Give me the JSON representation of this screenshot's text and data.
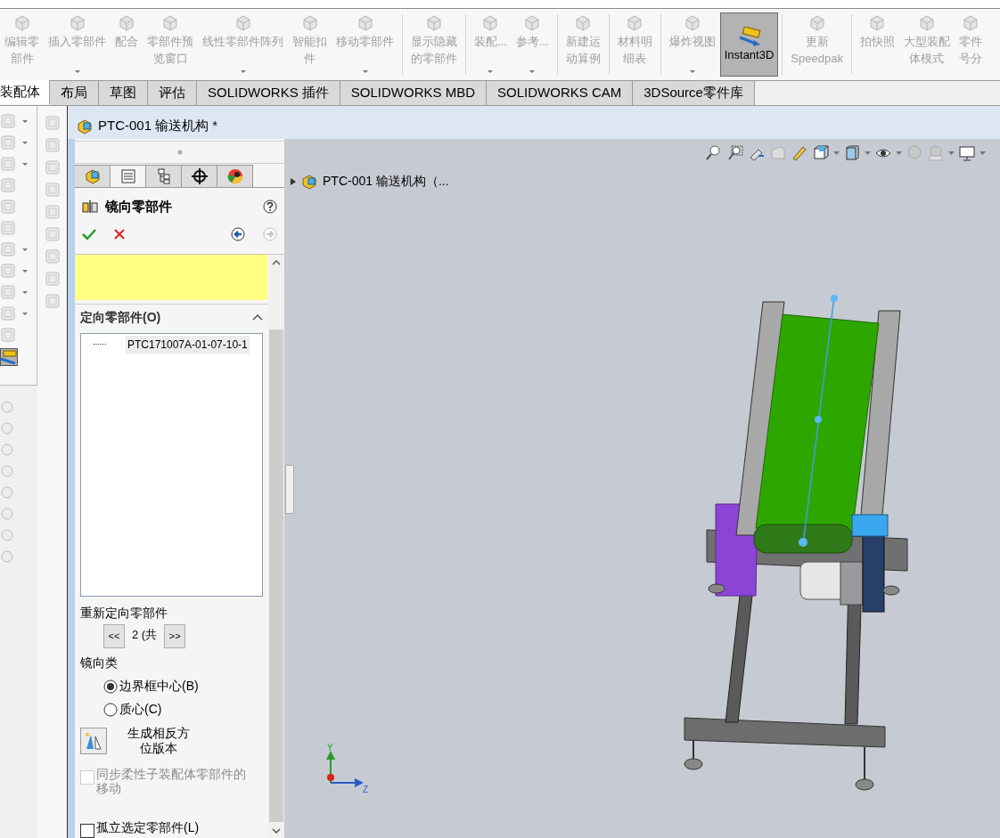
{
  "ribbon": {
    "items": [
      {
        "kind": "button",
        "lines": [
          "编辑零",
          "部件"
        ],
        "disabled": true,
        "dropdown": false,
        "selected": false
      },
      {
        "kind": "button",
        "lines": [
          "插入零部件"
        ],
        "disabled": true,
        "dropdown": true,
        "selected": false
      },
      {
        "kind": "button",
        "lines": [
          "配合"
        ],
        "disabled": true,
        "dropdown": false,
        "selected": false
      },
      {
        "kind": "button",
        "lines": [
          "零部件预",
          "览窗口"
        ],
        "disabled": true,
        "dropdown": false,
        "selected": false
      },
      {
        "kind": "button",
        "lines": [
          "线性零部件阵列"
        ],
        "disabled": true,
        "dropdown": true,
        "selected": false
      },
      {
        "kind": "button",
        "lines": [
          "智能扣",
          "件"
        ],
        "disabled": true,
        "dropdown": false,
        "selected": false
      },
      {
        "kind": "button",
        "lines": [
          "移动零部件"
        ],
        "disabled": true,
        "dropdown": true,
        "selected": false
      },
      {
        "kind": "separator"
      },
      {
        "kind": "button",
        "lines": [
          "显示隐藏",
          "的零部件"
        ],
        "disabled": true,
        "dropdown": false,
        "selected": false
      },
      {
        "kind": "separator"
      },
      {
        "kind": "button",
        "lines": [
          "装配..."
        ],
        "disabled": true,
        "dropdown": true,
        "selected": false
      },
      {
        "kind": "button",
        "lines": [
          "参考..."
        ],
        "disabled": true,
        "dropdown": true,
        "selected": false
      },
      {
        "kind": "separator"
      },
      {
        "kind": "button",
        "lines": [
          "新建运",
          "动算例"
        ],
        "disabled": true,
        "dropdown": false,
        "selected": false
      },
      {
        "kind": "separator"
      },
      {
        "kind": "button",
        "lines": [
          "材料明",
          "细表"
        ],
        "disabled": true,
        "dropdown": false,
        "selected": false
      },
      {
        "kind": "separator"
      },
      {
        "kind": "button",
        "lines": [
          "爆炸视图"
        ],
        "disabled": true,
        "dropdown": true,
        "selected": false
      },
      {
        "kind": "button",
        "lines": [
          "Instant3D"
        ],
        "disabled": false,
        "dropdown": false,
        "selected": true
      },
      {
        "kind": "separator"
      },
      {
        "kind": "button",
        "lines": [
          "更新",
          "Speedpak"
        ],
        "disabled": true,
        "dropdown": false,
        "selected": false
      },
      {
        "kind": "separator"
      },
      {
        "kind": "button",
        "lines": [
          "拍快照"
        ],
        "disabled": true,
        "dropdown": false,
        "selected": false
      },
      {
        "kind": "button",
        "lines": [
          "大型装配",
          "体模式"
        ],
        "disabled": true,
        "dropdown": false,
        "selected": false
      },
      {
        "kind": "button",
        "lines": [
          "零件",
          "号分"
        ],
        "disabled": true,
        "dropdown": false,
        "selected": false
      }
    ]
  },
  "tabs": [
    {
      "label": "装配体",
      "selected": true
    },
    {
      "label": "布局",
      "selected": false
    },
    {
      "label": "草图",
      "selected": false
    },
    {
      "label": "评估",
      "selected": false
    },
    {
      "label": "SOLIDWORKS 插件",
      "selected": false
    },
    {
      "label": "SOLIDWORKS MBD",
      "selected": false
    },
    {
      "label": "SOLIDWORKS CAM",
      "selected": false
    },
    {
      "label": "3DSource零件库",
      "selected": false
    }
  ],
  "document": {
    "title": "PTC-001 输送机构 *"
  },
  "property_manager": {
    "tabs": [
      {
        "kind": "feature",
        "selected": false
      },
      {
        "kind": "property",
        "selected": true
      },
      {
        "kind": "config",
        "selected": false
      },
      {
        "kind": "dimxpert",
        "selected": false
      },
      {
        "kind": "display",
        "selected": false
      }
    ],
    "title": "镜向零部件",
    "forward_disabled": true,
    "section": {
      "title": "定向零部件(O)",
      "expanded": true,
      "items": [
        "PTC171007A-01-07-10-1"
      ]
    },
    "reorient": {
      "label": "重新定向零部件",
      "prev": "<<",
      "count": "2 (共",
      "next": ">>"
    },
    "mirror_type": {
      "label": "镜向类",
      "options": [
        {
          "label": "边界框中心(B)",
          "selected": true
        },
        {
          "label": "质心(C)",
          "selected": false
        }
      ]
    },
    "opposite_button": {
      "label": "生成相反方位版本"
    },
    "checkboxes": [
      {
        "label": "同步柔性子装配体零部件的移动",
        "checked": false,
        "disabled": true
      },
      {
        "label": "孤立选定零部件(L)",
        "checked": false,
        "disabled": false
      }
    ]
  },
  "viewport": {
    "tree_item": "PTC-001 输送机构（...",
    "axes": [
      "Y",
      "Z"
    ]
  }
}
